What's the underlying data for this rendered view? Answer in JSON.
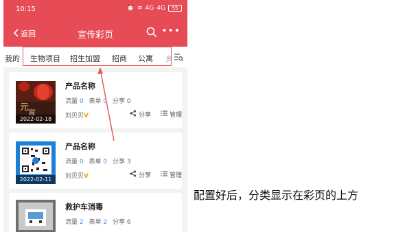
{
  "status_bar": {
    "time": "10:15",
    "signal1": "4G",
    "signal2": "4G",
    "battery": "55"
  },
  "header": {
    "back_label": "返回",
    "title": "宣传彩页",
    "more_label": "•••"
  },
  "tabs": {
    "partial_left": "我的",
    "items": [
      "生物项目",
      "招生加盟",
      "招商",
      "公寓"
    ],
    "partial_right": "乡"
  },
  "cards": [
    {
      "name": "产品名称",
      "flow_label": "流量",
      "flow": "0",
      "form_label": "表单",
      "form": "0",
      "share_label": "分享",
      "share_count": "0",
      "owner": "刘贝贝",
      "verified": "V",
      "date": "2022-02-18",
      "share_btn": "分享",
      "manage_btn": "管理"
    },
    {
      "name": "产品名称",
      "flow_label": "流量",
      "flow": "0",
      "form_label": "表单",
      "form": "0",
      "share_label": "分享",
      "share_count": "3",
      "owner": "刘贝贝",
      "verified": "V",
      "date": "2022-02-11",
      "share_btn": "分享",
      "manage_btn": "管理"
    },
    {
      "name": "救护车消毒",
      "flow_label": "流量",
      "flow": "2",
      "form_label": "表单",
      "form": "2",
      "share_label": "分享",
      "share_count": "6"
    }
  ],
  "annotation": {
    "caption": "配置好后，分类显示在彩页的上方"
  },
  "colors": {
    "brand": "#e64b56",
    "highlight": "#e35d5d",
    "link": "#3a8ee6",
    "verified": "#f39c12"
  }
}
